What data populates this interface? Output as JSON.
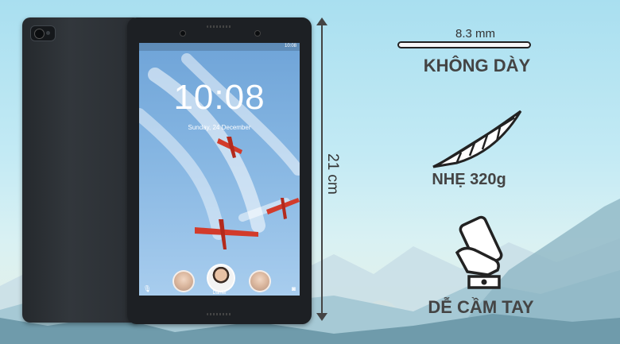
{
  "specs": {
    "thickness_value": "8.3 mm",
    "thickness_label": "KHÔNG DÀY",
    "height_value": "21 cm",
    "weight_label": "NHẸ 320g",
    "grip_label": "DỄ CẦM TAY"
  },
  "tablet_screen": {
    "clock": "10:08",
    "date": "Sunday, 24 December",
    "status_time": "10:08",
    "user_name": "Daniel"
  },
  "icons": [
    "feather-icon",
    "hand-holding-phone-icon",
    "microphone-icon",
    "camera-icon"
  ],
  "colors": {
    "sky": "#a9dff0",
    "text": "#444444",
    "device": "#1d2024"
  }
}
